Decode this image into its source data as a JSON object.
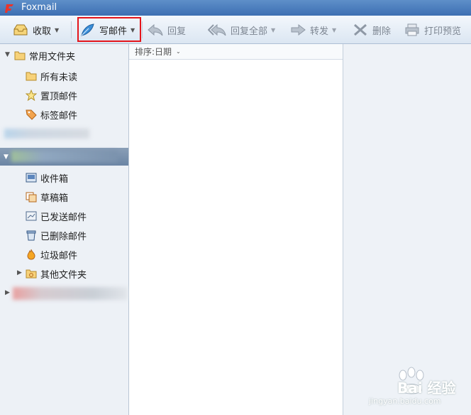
{
  "window": {
    "title": "Foxmail"
  },
  "toolbar": {
    "receive": "收取",
    "compose": "写邮件",
    "reply": "回复",
    "reply_all": "回复全部",
    "forward": "转发",
    "delete": "删除",
    "print_preview": "打印预览"
  },
  "sidebar": {
    "common_folders": "常用文件夹",
    "all_unread": "所有未读",
    "pinned": "置顶邮件",
    "tagged": "标签邮件",
    "inbox": "收件箱",
    "drafts": "草稿箱",
    "sent": "已发送邮件",
    "deleted": "已删除邮件",
    "junk": "垃圾邮件",
    "other_folders": "其他文件夹"
  },
  "list": {
    "sort_label": "排序:日期"
  },
  "watermark": {
    "text": "Bai 经验",
    "url": "jingyan.baidu.com"
  }
}
